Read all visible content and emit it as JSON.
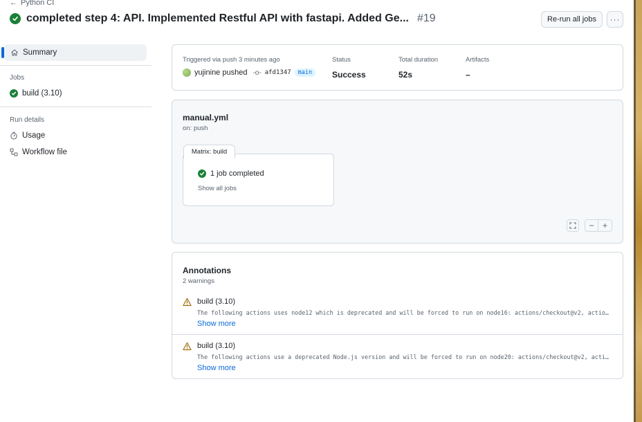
{
  "header": {
    "back_label": "Python CI",
    "title": "completed step 4: API. Implemented Restful API with fastapi. Added Ge...",
    "run_number": "#19",
    "rerun_label": "Re-run all jobs",
    "more_label": "···"
  },
  "sidebar": {
    "summary_label": "Summary",
    "jobs_heading": "Jobs",
    "job_label": "build (3.10)",
    "details_heading": "Run details",
    "usage_label": "Usage",
    "workflow_file_label": "Workflow file"
  },
  "summary": {
    "trigger_label": "Triggered via push 3 minutes ago",
    "actor": "yujinine pushed",
    "commit_sha": "afd1347",
    "branch": "main",
    "status_label": "Status",
    "status_value": "Success",
    "duration_label": "Total duration",
    "duration_value": "52s",
    "artifacts_label": "Artifacts",
    "artifacts_value": "–"
  },
  "workflow": {
    "file_name": "manual.yml",
    "trigger": "on: push",
    "matrix_label": "Matrix: build",
    "matrix_status": "1 job completed",
    "show_all_jobs": "Show all jobs"
  },
  "annotations": {
    "title": "Annotations",
    "count_label": "2 warnings",
    "items": [
      {
        "job": "build (3.10)",
        "message": "The following actions uses node12 which is deprecated and will be forced to run on node16: actions/checkout@v2, actions/…",
        "more": "Show more"
      },
      {
        "job": "build (3.10)",
        "message": "The following actions use a deprecated Node.js version and will be forced to run on node20: actions/checkout@v2, actions…",
        "more": "Show more"
      }
    ]
  },
  "colors": {
    "success": "#1a7f37",
    "link": "#0969da",
    "warning": "#9a6700",
    "border": "#d1d9e0",
    "selected_marker": "#0969da"
  }
}
